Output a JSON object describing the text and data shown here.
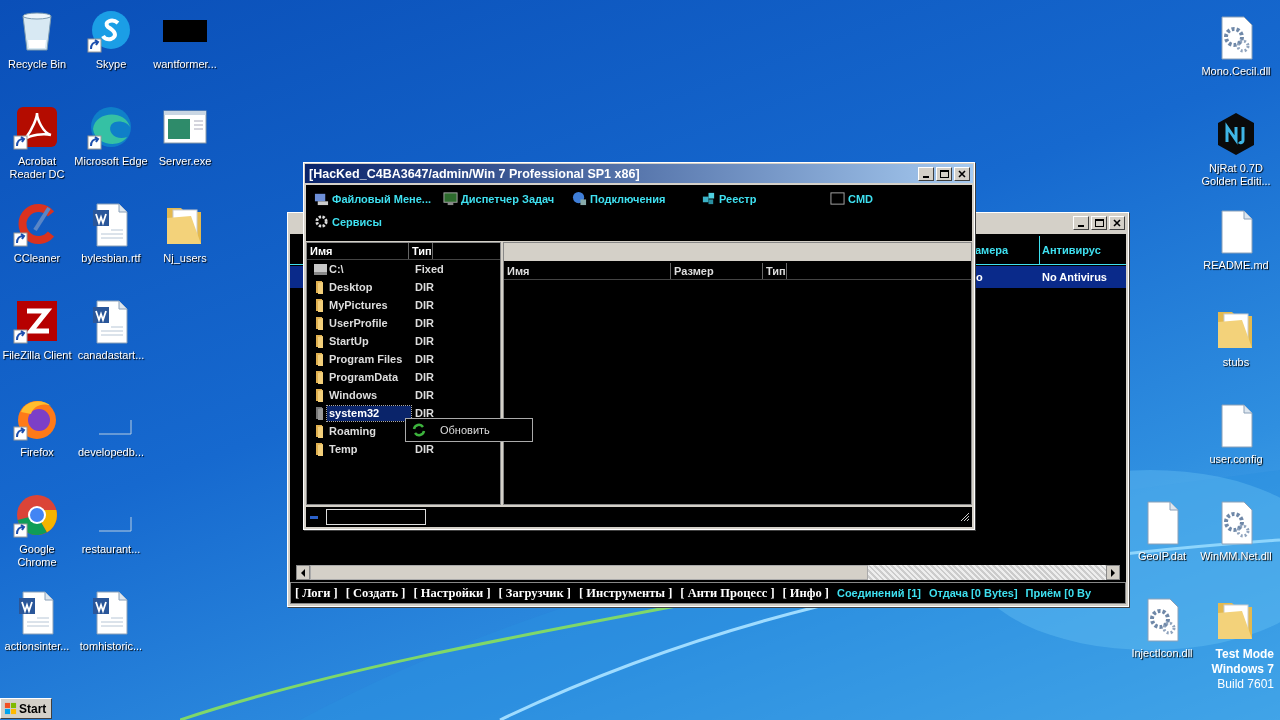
{
  "desktop": {
    "left_columns": [
      [
        {
          "label": "Recycle Bin",
          "kind": "recycle",
          "shortcut": false
        },
        {
          "label": "Acrobat Reader DC",
          "kind": "acrobat",
          "shortcut": true
        },
        {
          "label": "CCleaner",
          "kind": "ccleaner",
          "shortcut": true
        },
        {
          "label": "FileZilla Client",
          "kind": "filezilla",
          "shortcut": true
        },
        {
          "label": "Firefox",
          "kind": "firefox",
          "shortcut": true
        },
        {
          "label": "Google Chrome",
          "kind": "chrome",
          "shortcut": true
        },
        {
          "label": "actionsinter...",
          "kind": "word",
          "shortcut": false
        }
      ],
      [
        {
          "label": "Skype",
          "kind": "skype",
          "shortcut": true
        },
        {
          "label": "Microsoft Edge",
          "kind": "edge",
          "shortcut": true
        },
        {
          "label": "bylesbian.rtf",
          "kind": "word",
          "shortcut": false
        },
        {
          "label": "canadastart...",
          "kind": "word",
          "shortcut": false
        },
        {
          "label": "developedb...",
          "kind": "blank",
          "shortcut": false
        },
        {
          "label": "restaurant...",
          "kind": "blank",
          "shortcut": false
        },
        {
          "label": "tomhistoric...",
          "kind": "word",
          "shortcut": false
        }
      ],
      [
        {
          "label": "wantformer...",
          "kind": "thumb",
          "shortcut": false
        },
        {
          "label": "Server.exe",
          "kind": "exe",
          "shortcut": false
        },
        {
          "label": "Nj_users",
          "kind": "folder",
          "shortcut": false
        }
      ]
    ],
    "right_columns": [
      [
        {
          "label": "GeoIP.dat",
          "kind": "page",
          "shortcut": false
        },
        {
          "label": "InjectIcon.dll",
          "kind": "gear",
          "shortcut": false
        }
      ],
      [
        {
          "label": "Mono.Cecil.dll",
          "kind": "gear",
          "shortcut": false
        },
        {
          "label": "NjRat 0.7D Golden Editi...",
          "kind": "njrat",
          "shortcut": false
        },
        {
          "label": "README.md",
          "kind": "page",
          "shortcut": false
        },
        {
          "label": "stubs",
          "kind": "folder",
          "shortcut": false
        },
        {
          "label": "user.config",
          "kind": "page",
          "shortcut": false
        },
        {
          "label": "WinMM.Net.dll",
          "kind": "gear",
          "shortcut": false
        },
        {
          "kind": "folder",
          "shortcut": false
        }
      ]
    ]
  },
  "main_window": {
    "columns": [
      "амера",
      "Антивирус"
    ],
    "rows": [
      {
        "cells": [
          "o",
          "No Antivirus"
        ],
        "selected": true
      }
    ],
    "bottom_menu": [
      "[ Логи ]",
      "[ Создать ]",
      "[ Настройки ]",
      "[ Загрузчик ]",
      "[ Инструменты ]",
      "[ Анти Процесс ]",
      "[ Инфо ]"
    ],
    "status": [
      "Соединений [1]",
      "Отдача [0 Bytes]",
      "Приём [0 By"
    ]
  },
  "file_window": {
    "title": "[HacKed_C4BA3647/admin/Win 7 Professional SP1 x86]",
    "toolbar": [
      {
        "label": "Файловый Мене...",
        "kind": "files"
      },
      {
        "label": "Диспетчер Задач",
        "kind": "tasks"
      },
      {
        "label": "Подключения",
        "kind": "network"
      },
      {
        "label": "Реестр",
        "kind": "registry"
      },
      {
        "label": "CMD",
        "kind": "cmd"
      },
      {
        "label": "Сервисы",
        "kind": "services"
      }
    ],
    "tree_columns": [
      "Имя",
      "Тип"
    ],
    "tree_rows": [
      {
        "name": "C:\\",
        "type": "Fixed",
        "kind": "drive",
        "selected": false
      },
      {
        "name": "Desktop",
        "type": "DIR",
        "kind": "folder",
        "selected": false
      },
      {
        "name": "MyPictures",
        "type": "DIR",
        "kind": "folder",
        "selected": false
      },
      {
        "name": "UserProfile",
        "type": "DIR",
        "kind": "folder",
        "selected": false
      },
      {
        "name": "StartUp",
        "type": "DIR",
        "kind": "folder",
        "selected": false
      },
      {
        "name": "Program Files",
        "type": "DIR",
        "kind": "folder",
        "selected": false
      },
      {
        "name": "ProgramData",
        "type": "DIR",
        "kind": "folder",
        "selected": false
      },
      {
        "name": "Windows",
        "type": "DIR",
        "kind": "folder",
        "selected": false
      },
      {
        "name": "system32",
        "type": "DIR",
        "kind": "folder",
        "selected": true
      },
      {
        "name": "Roaming",
        "kind": "folder",
        "selected": false
      },
      {
        "name": "Temp",
        "type": "DIR",
        "kind": "folder",
        "selected": false
      }
    ],
    "list_columns": [
      "Имя",
      "Размер",
      "Тип"
    ],
    "context_menu": [
      {
        "label": "Обновить"
      }
    ]
  },
  "os_notice": [
    "Test Mode",
    "Windows 7",
    "Build 7601"
  ],
  "taskbar": {
    "start": "Start"
  }
}
